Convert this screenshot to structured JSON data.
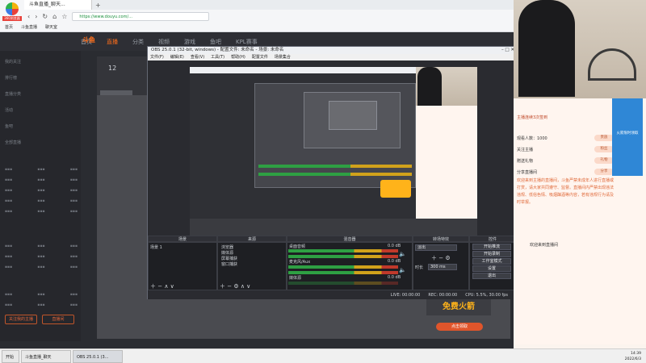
{
  "browser": {
    "tab_title": "斗鱼直播_聊天...",
    "url": "https://www.douyu.com/...",
    "bookmarks": [
      "首页",
      "斗鱼直播",
      "聊天室"
    ],
    "logo_tag": "360浏览器"
  },
  "douyu": {
    "logo": "斗鱼",
    "nav": [
      "首页",
      "直播",
      "分类",
      "视频",
      "游戏",
      "鱼吧",
      "KPL赛事"
    ],
    "nav_active_index": 1,
    "sidebar": [
      "我的关注",
      "排行榜",
      "直播分类",
      "活动",
      "鱼吧",
      "全部直播"
    ],
    "room_number": "12",
    "favorite_left": "关注我的主播",
    "favorite_right": "直播间",
    "promo_text": "免费火箭",
    "promo_sub": "点击领取"
  },
  "obs": {
    "title": "OBS 25.0.1 (32-bit, windows) - 配置文件: 未命名 - 场景: 未命名",
    "menu": [
      "文件(F)",
      "编辑(E)",
      "查看(V)",
      "工具(T)",
      "帮助(H)",
      "配置文件",
      "场景集合"
    ],
    "docks": {
      "scenes": "场景",
      "sources": "来源",
      "mixer": "混音器",
      "transitions": "转场特效",
      "controls": "控件"
    },
    "scene_item": "场景 1",
    "source_items": [
      "浏览器",
      "媒体源",
      "屏幕捕获",
      "窗口捕获"
    ],
    "mixer_channels": [
      {
        "name": "桌面音频",
        "level": "0.0 dB"
      },
      {
        "name": "麦克风/Aux",
        "level": "0.0 dB"
      },
      {
        "name": "媒体源",
        "level": "0.0 dB"
      }
    ],
    "transition": "淡出",
    "duration_label": "时长",
    "duration_value": "300 ms",
    "controls": [
      "开始推流",
      "开始录制",
      "工作室模式",
      "设置",
      "退出"
    ],
    "status": {
      "live": "LIVE: 00:00:00",
      "rec": "REC: 00:00:00",
      "cpu": "CPU: 5.5%, 30.00 fps"
    }
  },
  "chat": {
    "title": "主播连续3次签到",
    "items": [
      {
        "text": "观看人数：1000",
        "badge": "贵族"
      },
      {
        "text": "关注主播",
        "badge": "粉丝"
      },
      {
        "text": "赠送礼物",
        "badge": "礼物"
      },
      {
        "text": "分享直播间",
        "badge": "分享"
      }
    ],
    "message": "欢迎来到主播的直播间，斗鱼严禁未成年人进行直播或打赏，请大家共同遵守、监督。直播间内严禁出现违法违规、低俗色情、吸烟酗酒等内容，若有违规行为请及时举报。",
    "footer": "欢迎来到直播间",
    "promo": "火箭限时领取"
  },
  "taskbar": {
    "start": "开始",
    "tasks": [
      "斗鱼直播_聊天",
      "OBS 25.0.1 (3..."
    ],
    "time": "14:39",
    "date": "2022/6/3"
  },
  "colors": {
    "accent": "#ff6e1a",
    "obs_bg": "#2a2b30",
    "meter_green": "#2ea043"
  }
}
